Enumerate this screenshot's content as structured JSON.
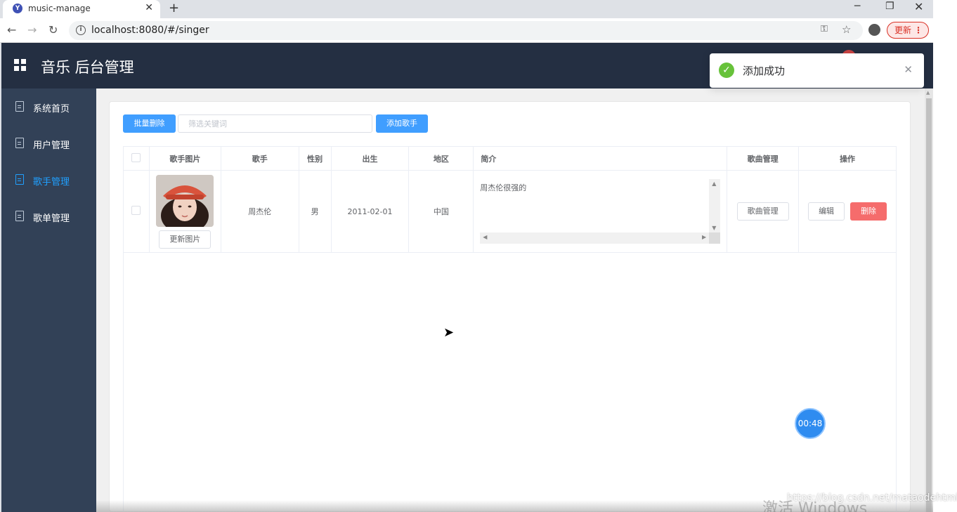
{
  "browser": {
    "tab_title": "music-manage",
    "favicon_letter": "Y",
    "new_tab_symbol": "+",
    "url": "localhost:8080/#/singer",
    "update_label": "更新"
  },
  "app": {
    "title": "音乐 后台管理"
  },
  "sidebar": {
    "items": [
      {
        "label": "系统首页",
        "icon": "document-icon"
      },
      {
        "label": "用户管理",
        "icon": "document-icon"
      },
      {
        "label": "歌手管理",
        "icon": "document-icon",
        "active": true
      },
      {
        "label": "歌单管理",
        "icon": "document-icon"
      }
    ]
  },
  "toolbar": {
    "batch_delete_label": "批量删除",
    "search_placeholder": "筛选关键词",
    "add_singer_label": "添加歌手"
  },
  "table": {
    "headers": [
      "歌手图片",
      "歌手",
      "性别",
      "出生",
      "地区",
      "简介",
      "歌曲管理",
      "操作"
    ],
    "rows": [
      {
        "update_pic_label": "更新图片",
        "name": "周杰伦",
        "sex": "男",
        "birth": "2011-02-01",
        "location": "中国",
        "introduction": "周杰伦很强的",
        "song_mgmt_label": "歌曲管理",
        "edit_label": "编辑",
        "delete_label": "删除"
      }
    ]
  },
  "toast": {
    "message": "添加成功"
  },
  "overlay": {
    "timer": "00:48",
    "watermark_blog": "https://blog.csdn.net/mataodehtml",
    "watermark_windows": "激活 Windows"
  },
  "colors": {
    "header_bg": "#242f42",
    "sidebar_bg": "#324157",
    "active": "#20a0ff",
    "primary": "#409eff",
    "danger": "#f56c6c",
    "success": "#67c23a"
  }
}
